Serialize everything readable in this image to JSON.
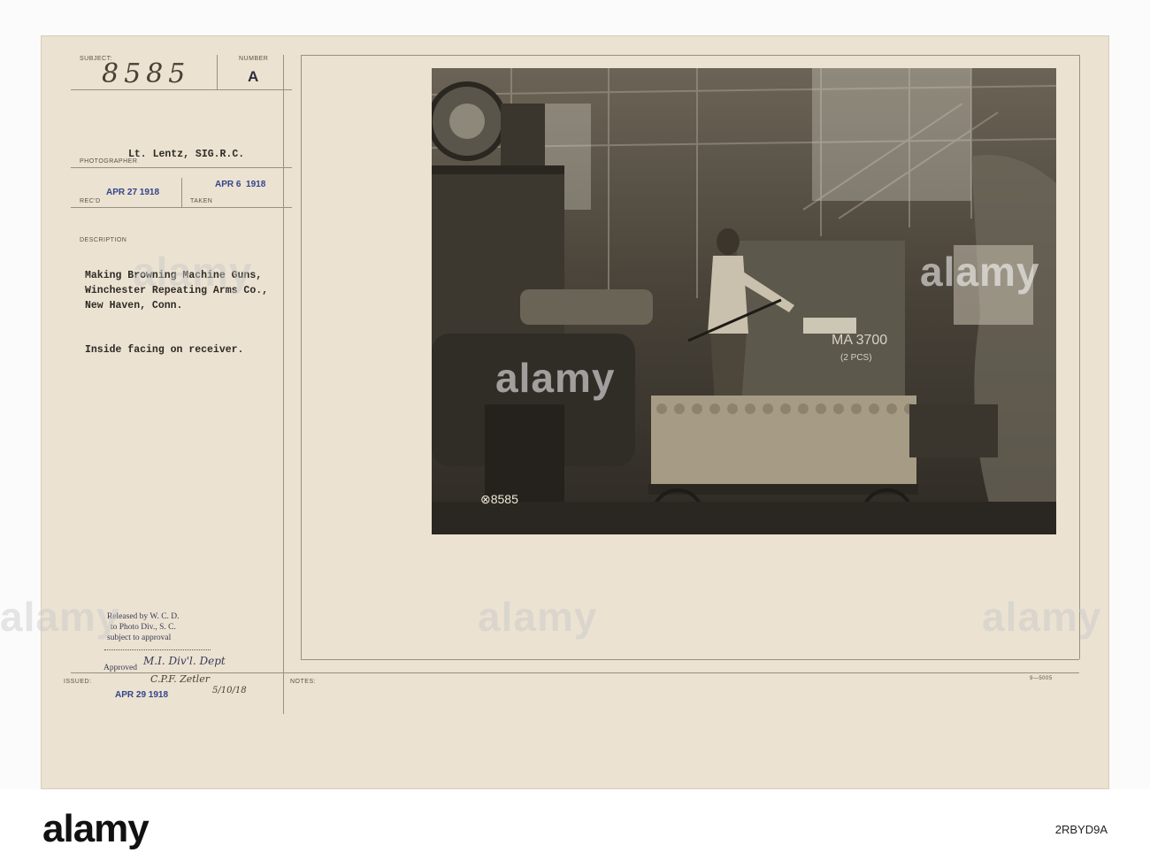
{
  "header": {
    "subject_label": "SUBJECT:",
    "subject_number": "8585",
    "number_label": "NUMBER",
    "number_value": "A"
  },
  "photographer": {
    "label": "PHOTOGRAPHER",
    "name": "Lt. Lentz, SIG.R.C."
  },
  "dates": {
    "received_label": "REC'D",
    "received": "APR 27 1918",
    "taken_label": "TAKEN",
    "taken": "APR 6  1918"
  },
  "description": {
    "label": "DESCRIPTION",
    "lines": [
      "Making Browning Machine Guns,",
      "Winchester Repeating Arms Co.,",
      "New Haven, Conn."
    ],
    "caption": "Inside facing on receiver."
  },
  "release": {
    "lines": [
      "Released by W. C. D.",
      "to Photo Div., S. C.",
      "subject to approval"
    ],
    "approved_label": "Approved",
    "approved_by": "M.I. Div'l. Dept",
    "signature": "C.P.F. Zetler",
    "signature_date": "5/10/18"
  },
  "issued": {
    "label": "ISSUED:",
    "date": "APR 29 1918"
  },
  "notes_label": "NOTES:",
  "form_code": "9—5005",
  "photo": {
    "negative_mark": "⊗8585",
    "crate_text": "MA 3700",
    "crate_sub": "(2 PCS)"
  },
  "watermarks": [
    "alamy",
    "alamy",
    "alamy",
    "alamy",
    "alamy",
    "alamy"
  ],
  "footer": {
    "logo": "alamy",
    "image_code": "2RBYD9A"
  }
}
